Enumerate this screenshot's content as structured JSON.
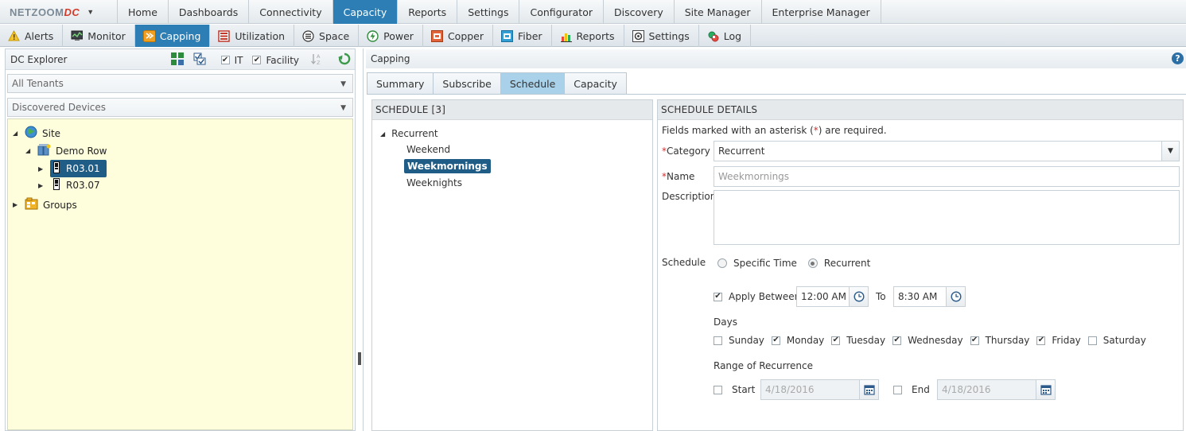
{
  "topnav": {
    "logo_net": "NETZOOM",
    "logo_dc": "DC",
    "items": [
      "Home",
      "Dashboards",
      "Connectivity",
      "Capacity",
      "Reports",
      "Settings",
      "Configurator",
      "Discovery",
      "Site Manager",
      "Enterprise Manager"
    ],
    "active": "Capacity"
  },
  "subnav": {
    "items": [
      {
        "label": "Alerts",
        "icon": "alert-icon"
      },
      {
        "label": "Monitor",
        "icon": "monitor-icon"
      },
      {
        "label": "Capping",
        "icon": "capping-icon"
      },
      {
        "label": "Utilization",
        "icon": "utilization-icon"
      },
      {
        "label": "Space",
        "icon": "space-icon"
      },
      {
        "label": "Power",
        "icon": "power-icon"
      },
      {
        "label": "Copper",
        "icon": "copper-icon"
      },
      {
        "label": "Fiber",
        "icon": "fiber-icon"
      },
      {
        "label": "Reports",
        "icon": "reports-icon"
      },
      {
        "label": "Settings",
        "icon": "settings-icon"
      },
      {
        "label": "Log",
        "icon": "log-icon"
      }
    ],
    "active": "Capping"
  },
  "explorer": {
    "title": "DC Explorer",
    "it_label": "IT",
    "facility_label": "Facility",
    "tenant_select": "All Tenants",
    "device_select": "Discovered Devices",
    "tree": {
      "site": "Site",
      "row": "Demo Row",
      "rack1": "R03.01",
      "rack2": "R03.07",
      "groups": "Groups"
    }
  },
  "capping": {
    "title": "Capping",
    "tabs": [
      "Summary",
      "Subscribe",
      "Schedule",
      "Capacity"
    ],
    "active_tab": "Schedule"
  },
  "schedule": {
    "header": "SCHEDULE [3]",
    "group": "Recurrent",
    "items": [
      "Weekend",
      "Weekmornings",
      "Weeknights"
    ],
    "selected": "Weekmornings"
  },
  "details": {
    "header": "SCHEDULE DETAILS",
    "note_pre": "Fields marked with an asterisk (",
    "note_star": "*",
    "note_post": ") are required.",
    "star": "*",
    "category_label": "Category",
    "category_value": "Recurrent",
    "name_label": "Name",
    "name_placeholder": "Weekmornings",
    "description_label": "Description",
    "schedule_label": "Schedule",
    "specific_time": "Specific Time",
    "recurrent": "Recurrent",
    "apply_between": "Apply Between",
    "time_from": "12:00 AM",
    "to_label": "To",
    "time_to": "8:30 AM",
    "days_label": "Days",
    "days": [
      {
        "label": "Sunday",
        "checked": false
      },
      {
        "label": "Monday",
        "checked": true
      },
      {
        "label": "Tuesday",
        "checked": true
      },
      {
        "label": "Wednesday",
        "checked": true
      },
      {
        "label": "Thursday",
        "checked": true
      },
      {
        "label": "Friday",
        "checked": true
      },
      {
        "label": "Saturday",
        "checked": false
      }
    ],
    "range_label": "Range of Recurrence",
    "start_label": "Start",
    "start_date": "4/18/2016",
    "end_label": "End",
    "end_date": "4/18/2016"
  }
}
